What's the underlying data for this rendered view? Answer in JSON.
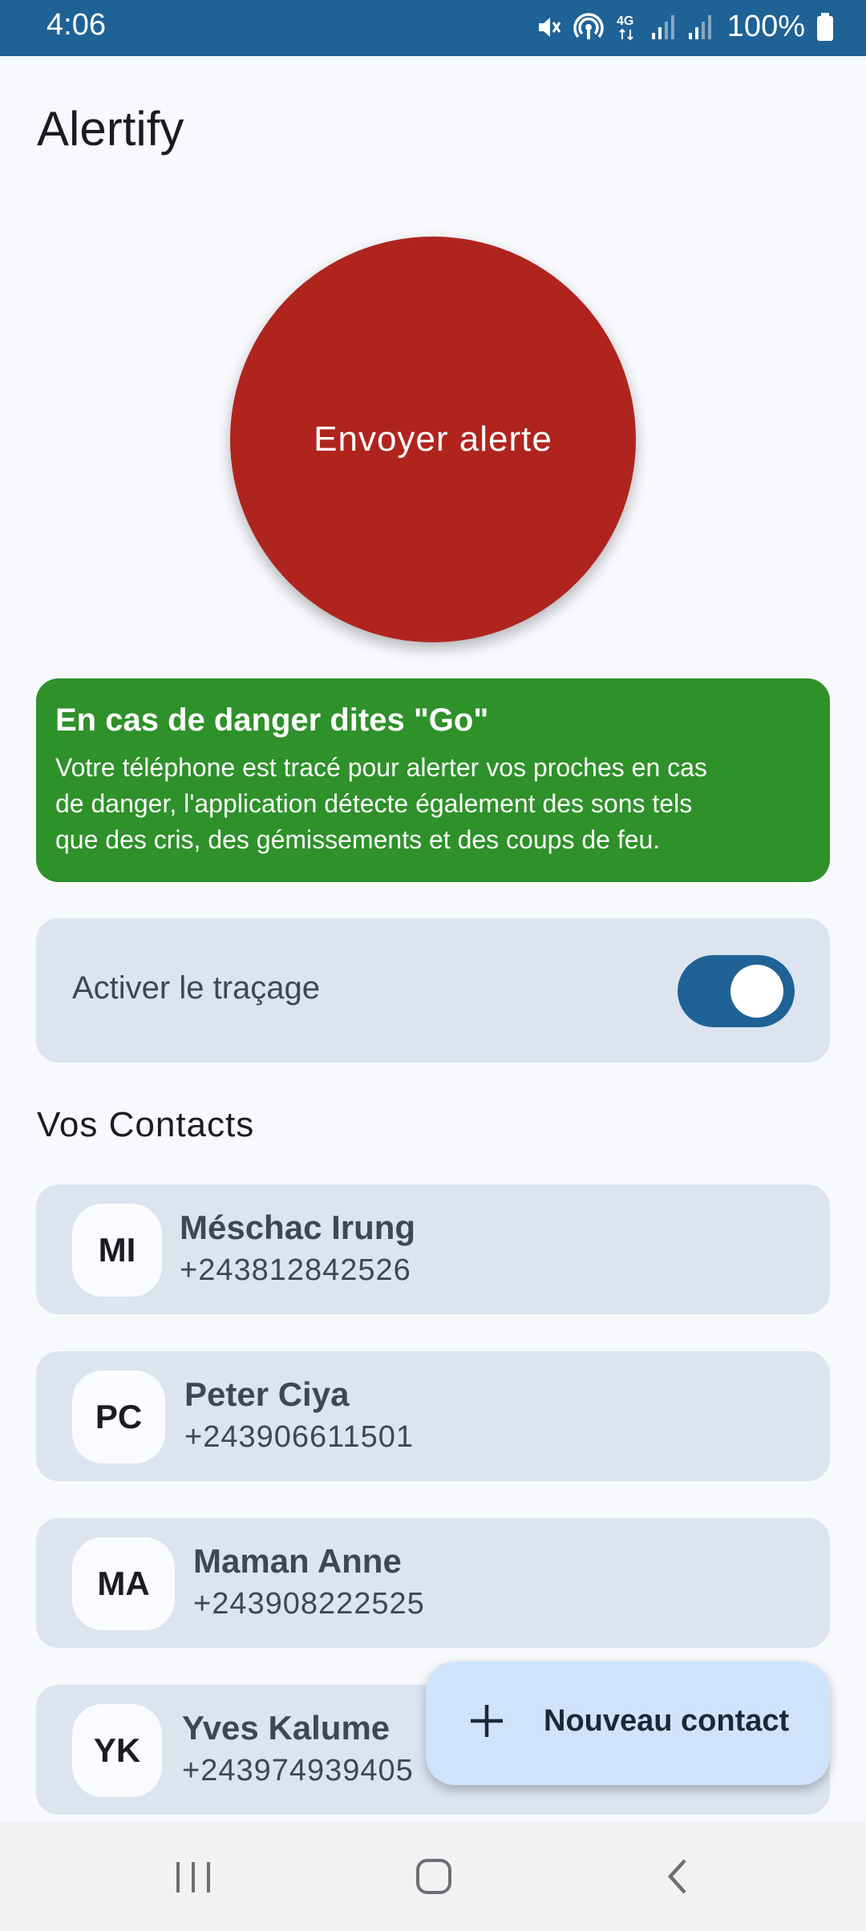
{
  "status_bar": {
    "time": "4:06",
    "battery": "100%",
    "icons": [
      "mute-icon",
      "hotspot-icon",
      "4g-icon",
      "signal-icon",
      "signal-icon",
      "battery-icon"
    ]
  },
  "app": {
    "title": "Alertify"
  },
  "alert_button": {
    "label": "Envoyer alerte",
    "color": "#B0241E"
  },
  "info_card": {
    "title": "En cas de danger dites \"Go\"",
    "lines": [
      "Votre téléphone est tracé pour alerter vos proches en cas",
      "de danger, l'application détecte également des sons tels",
      "que des cris, des gémissements et des coups de feu."
    ],
    "color": "#2E912A"
  },
  "tracking": {
    "label": "Activer le traçage",
    "enabled": true
  },
  "contacts_section": {
    "title": "Vos Contacts"
  },
  "contacts": [
    {
      "initials": "MI",
      "name": "Méschac Irung",
      "phone": "+243812842526"
    },
    {
      "initials": "PC",
      "name": "Peter Ciya",
      "phone": "+243906611501"
    },
    {
      "initials": "MA",
      "name": "Maman Anne",
      "phone": "+243908222525"
    },
    {
      "initials": "YK",
      "name": "Yves Kalume",
      "phone": "+243974939405"
    }
  ],
  "fab": {
    "label": "Nouveau contact",
    "icon": "plus-icon"
  },
  "nav": {
    "buttons": [
      "recents-icon",
      "home-icon",
      "back-icon"
    ]
  },
  "colors": {
    "primary": "#1F6295",
    "card": "#DCE4F0",
    "background": "#F8F9FD"
  }
}
